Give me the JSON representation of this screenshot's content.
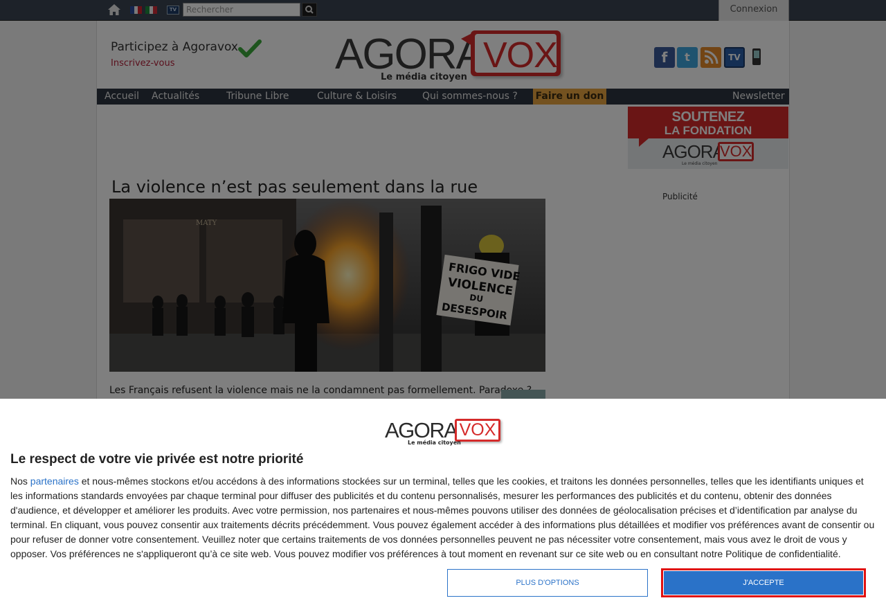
{
  "topbar": {
    "search_placeholder": "Rechercher",
    "login_label": "Connexion",
    "icons": [
      "home-icon",
      "flag-fr-icon",
      "flag-it-icon",
      "tv-icon",
      "search-icon"
    ]
  },
  "header": {
    "participate_text": "Participez à Agoravox",
    "signup_link": "Inscrivez-vous",
    "logo_agora": "AGORA",
    "logo_vox": "VOX",
    "logo_tagline": "Le média citoyen",
    "social_icons": [
      "facebook-icon",
      "twitter-icon",
      "rss-icon",
      "tv-icon",
      "mobile-icon"
    ]
  },
  "nav": {
    "items": [
      "Accueil",
      "Actualités",
      "Tribune Libre",
      "Culture & Loisirs",
      "Qui sommes-nous ?"
    ],
    "donate_label": "Faire un don",
    "newsletter_label": "Newsletter"
  },
  "sidebar": {
    "support_line1": "SOUTENEZ",
    "support_line2": "LA FONDATION",
    "support_logo_agora": "AGORA",
    "support_logo_vox": "VOX",
    "support_logo_tagline": "Le média citoyen",
    "ad_label": "Publicité"
  },
  "article": {
    "title": "La violence n’est pas seulement dans la rue",
    "sign_text": [
      "FRIGO VIDE",
      "VIOLENCE",
      "DU",
      "DESESPOIR"
    ],
    "storefront_text": "MATY",
    "lead": "Les Français refusent la violence mais ne la condamnent pas formellement. Paradoxe ?"
  },
  "consent": {
    "logo_agora": "AGORA",
    "logo_vox": "VOX",
    "logo_tagline": "Le média citoyen",
    "title": "Le respect de votre vie privée est notre priorité",
    "text_before_link": "Nos ",
    "partners_link": "partenaires",
    "text_after_link": " et nous-mêmes stockons et/ou accédons à des informations stockées sur un terminal, telles que les cookies, et traitons les données personnelles, telles que les identifiants uniques et les informations standards envoyées par chaque terminal pour diffuser des publicités et du contenu personnalisés, mesurer les performances des publicités et du contenu, obtenir des données d'audience, et développer et améliorer les produits. Avec votre permission, nos partenaires et nous-mêmes pouvons utiliser des données de géolocalisation précises et d’identification par analyse du terminal. En cliquant, vous pouvez consentir aux traitements décrits précédemment. Vous pouvez également accéder à des informations plus détaillées et modifier vos préférences avant de consentir ou pour refuser de donner votre consentement. Veuillez noter que certains traitements de vos données personnelles peuvent ne pas nécessiter votre consentement, mais vous avez le droit de vous y opposer. Vos préférences ne s'appliqueront qu’à ce site web. Vous pouvez modifier vos préférences à tout moment en revenant sur ce site web ou en consultant notre Politique de confidentialité.",
    "more_options_label": "PLUS D'OPTIONS",
    "accept_label": "J'ACCEPTE"
  },
  "colors": {
    "brand_red": "#d52a2a",
    "nav_dark": "#2d3540",
    "donate_orange": "#e8a541",
    "consent_blue": "#2a72c8",
    "highlight_red": "#e01010"
  }
}
